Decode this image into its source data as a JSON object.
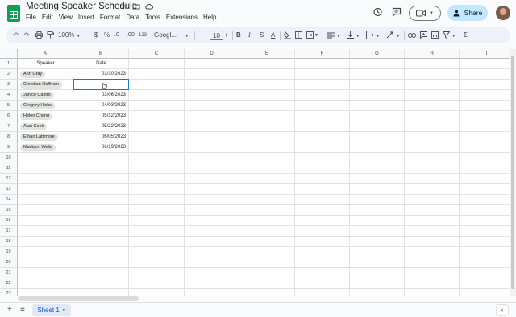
{
  "doc": {
    "title": "Meeting Speaker Schedule",
    "star_icon": "star-icon",
    "folder_icon": "move-folder-icon",
    "cloud_icon": "cloud-status-icon"
  },
  "menu": [
    "File",
    "Edit",
    "View",
    "Insert",
    "Format",
    "Data",
    "Tools",
    "Extensions",
    "Help"
  ],
  "header_actions": {
    "history_icon": "history-icon",
    "comments_icon": "comment-icon",
    "meet_icon": "video-camera-icon",
    "share_label": "Share"
  },
  "toolbar": {
    "zoom": "100%",
    "currency": "$",
    "percent": "%",
    "decrease_decimal": ".0",
    "increase_decimal": ".00",
    "number_format": "123",
    "font_family": "Googl...",
    "font_size": "10",
    "bold": "B",
    "italic": "I",
    "strikethrough": "S",
    "text_color": "A",
    "functions": "Σ"
  },
  "sheet": {
    "columns": [
      "A",
      "B",
      "C",
      "D",
      "E",
      "F",
      "G",
      "H",
      "I"
    ],
    "row_numbers": [
      "1",
      "2",
      "3",
      "4",
      "5",
      "6",
      "7",
      "8",
      "9",
      "10",
      "11",
      "12",
      "13",
      "14",
      "15",
      "16",
      "17",
      "18",
      "19",
      "20",
      "21",
      "22",
      "23"
    ],
    "headers": {
      "speaker": "Speaker",
      "date": "Date"
    },
    "rows": [
      {
        "speaker": "Ann Gray",
        "date": "01/30/2023"
      },
      {
        "speaker": "Christian Hoffman",
        "date": ""
      },
      {
        "speaker": "Janice Castro",
        "date": "03/06/2023"
      },
      {
        "speaker": "Gregory Hicks",
        "date": "04/03/2023"
      },
      {
        "speaker": "Helen Chang",
        "date": "05/12/2023"
      },
      {
        "speaker": "Alan Cook",
        "date": "05/22/2023"
      },
      {
        "speaker": "Ethan Lattimore",
        "date": "06/05/2023"
      },
      {
        "speaker": "Madison Wells",
        "date": "06/19/2023"
      }
    ]
  },
  "bottom": {
    "sheet_tab": "Sheet 1",
    "add_sheet_icon": "plus-icon",
    "all_sheets_icon": "list-icon"
  },
  "colors": {
    "brand_green": "#0f9d58",
    "share_bg": "#c2e7ff",
    "selection": "#1a73e8",
    "chip_bg": "#e1e3e1"
  }
}
